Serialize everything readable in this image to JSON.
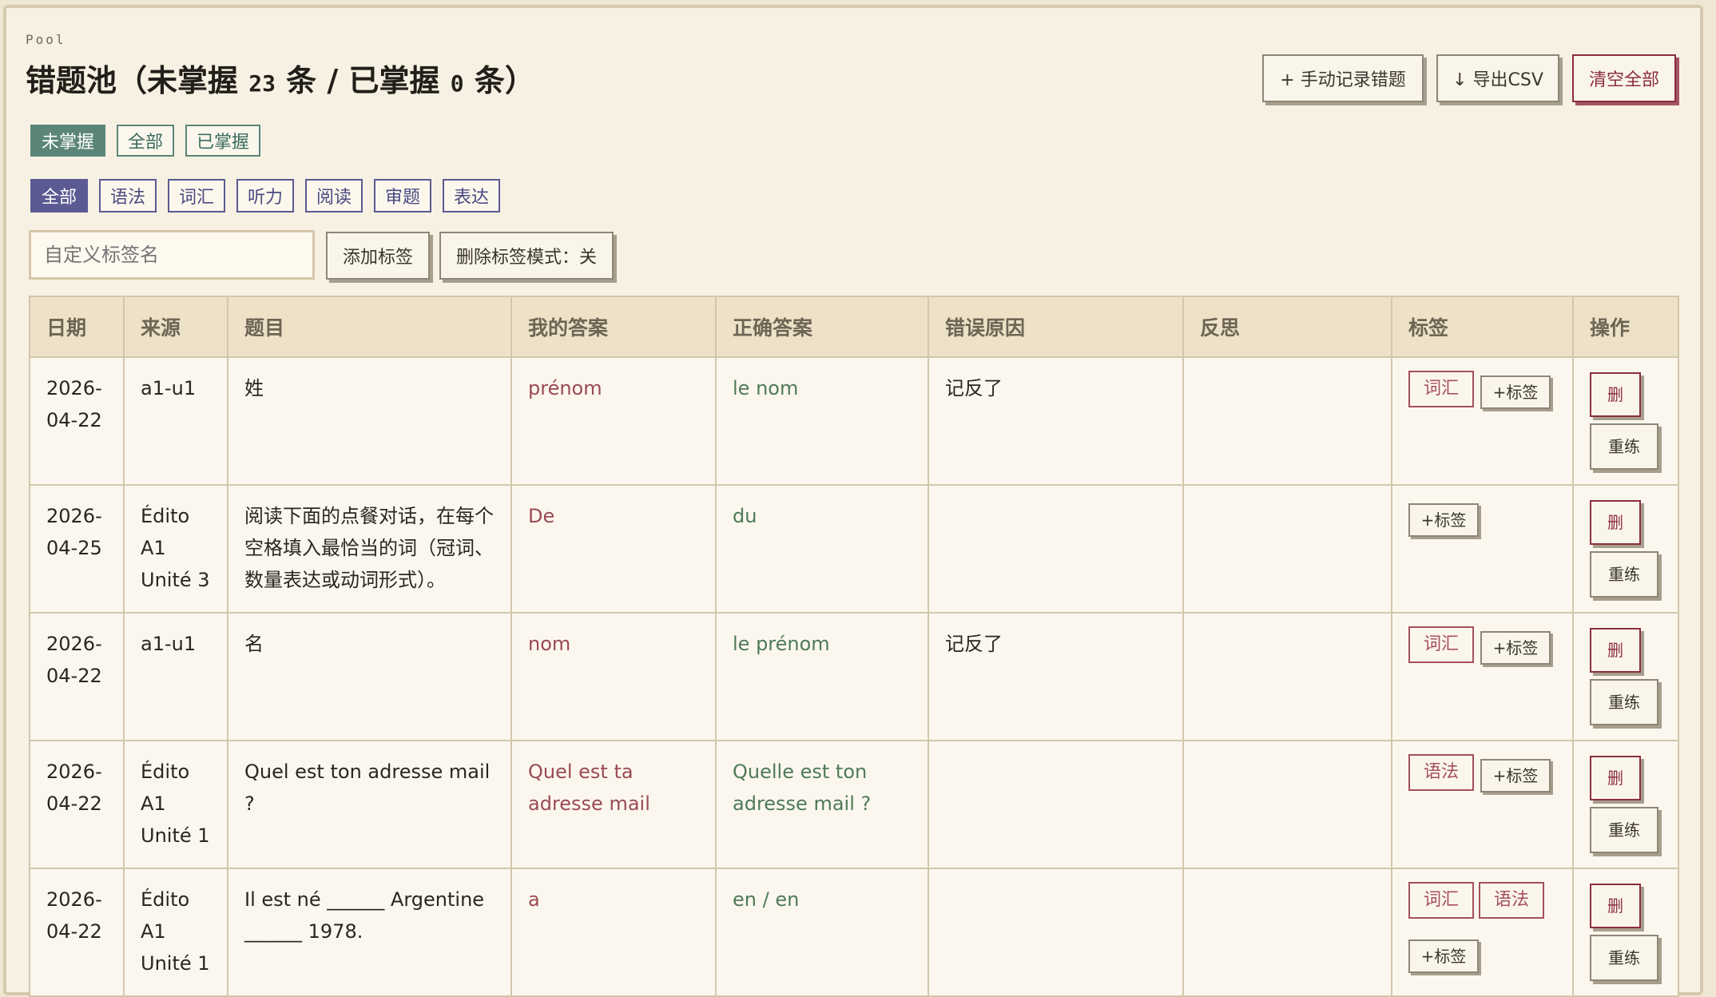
{
  "header": {
    "eyebrow": "Pool",
    "title_prefix": "错题池（未掌握 ",
    "unmastered_count": "23",
    "title_mid": " 条 / 已掌握 ",
    "mastered_count": "0",
    "title_suffix": " 条）"
  },
  "actions": {
    "manual_record": "+ 手动记录错题",
    "export_csv": "↓ 导出CSV",
    "clear_all": "清空全部"
  },
  "status_filters": [
    "未掌握",
    "全部",
    "已掌握"
  ],
  "category_filters": [
    "全部",
    "语法",
    "词汇",
    "听力",
    "阅读",
    "审题",
    "表达"
  ],
  "tag_input": {
    "placeholder": "自定义标签名",
    "value": ""
  },
  "tag_buttons": {
    "add": "添加标签",
    "delete_mode": "删除标签模式：关"
  },
  "table": {
    "columns": [
      "日期",
      "来源",
      "题目",
      "我的答案",
      "正确答案",
      "错误原因",
      "反思",
      "标签",
      "操作"
    ],
    "add_tag_label": "+标签",
    "delete_label": "删",
    "redo_label": "重练",
    "rows": [
      {
        "date": "2026-04-22",
        "source": "a1-u1",
        "question": "姓",
        "my_answer": "prénom",
        "correct": "le nom",
        "reason": "记反了",
        "reflection": "",
        "tags": [
          "词汇"
        ]
      },
      {
        "date": "2026-04-25",
        "source": "Édito A1 Unité 3",
        "question": "阅读下面的点餐对话，在每个空格填入最恰当的词（冠词、数量表达或动词形式）。",
        "my_answer": "De",
        "correct": "du",
        "reason": "",
        "reflection": "",
        "tags": []
      },
      {
        "date": "2026-04-22",
        "source": "a1-u1",
        "question": "名",
        "my_answer": "nom",
        "correct": "le prénom",
        "reason": "记反了",
        "reflection": "",
        "tags": [
          "词汇"
        ]
      },
      {
        "date": "2026-04-22",
        "source": "Édito A1 Unité 1",
        "question": "Quel est ton adresse mail ?",
        "my_answer": "Quel est ta adresse mail",
        "correct": "Quelle est ton adresse mail ?",
        "reason": "",
        "reflection": "",
        "tags": [
          "语法"
        ]
      },
      {
        "date": "2026-04-22",
        "source": "Édito A1 Unité 1",
        "question": "Il est né ______ Argentine ______ 1978.",
        "my_answer": "a",
        "correct": "en / en",
        "reason": "",
        "reflection": "",
        "tags": [
          "词汇",
          "语法"
        ]
      }
    ]
  },
  "colors": {
    "background": "#f7f1e3",
    "status_accent": "#5b8579",
    "category_accent": "#5b5a93",
    "danger": "#8a2f40",
    "my_answer": "#9b4a52",
    "correct_answer": "#4f7a57"
  }
}
